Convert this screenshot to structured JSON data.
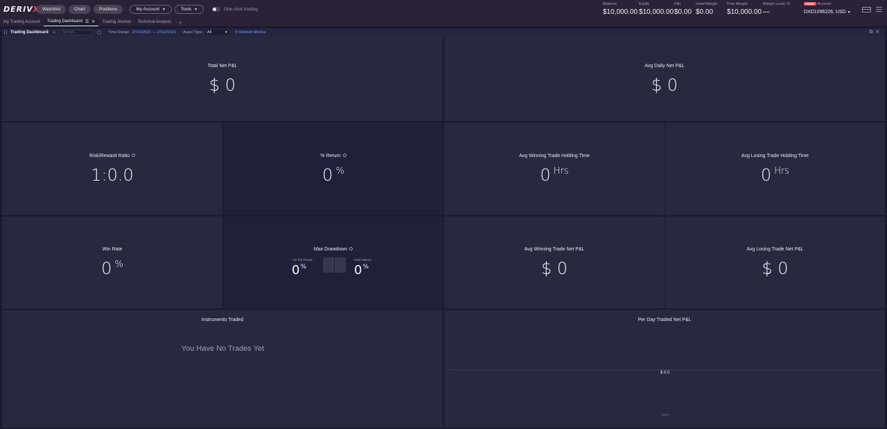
{
  "brand": {
    "logo_main": "DERIV",
    "logo_x": "X"
  },
  "topnav": {
    "watchlist": "Watchlist",
    "chart": "Chart",
    "positions": "Positions",
    "my_account": "My Account",
    "tools": "Tools",
    "one_click": "One-click trading"
  },
  "stats": {
    "balance": {
      "label": "Balance",
      "value": "$10,000.00"
    },
    "equity": {
      "label": "Equity",
      "value": "$10,000.00"
    },
    "pnl": {
      "label": "P&L",
      "value": "$0.00"
    },
    "used_margin": {
      "label": "Used Margin",
      "value": "$0.00"
    },
    "free_margin": {
      "label": "Free Margin",
      "value": "$10,000.00"
    },
    "margin_level": {
      "label": "Margin Level, %",
      "value": "—"
    },
    "account": {
      "badge": "DEMO",
      "label": "Account",
      "value": "DXD1096226, USD"
    }
  },
  "tabs": [
    "My Trading Account",
    "Trading Dashboard",
    "Trading Journal",
    "Technical Analysis"
  ],
  "toolbar": {
    "title": "Trading Dashboard",
    "symbol_placeholder": "Symbol...",
    "time_range_label": "Time Range:",
    "time_range_value": "27/12/2021 — 27/12/2021",
    "asset_type_label": "Asset Type:",
    "asset_type_value": "All",
    "refresh": "Refresh Metrics"
  },
  "metrics": {
    "total_net_pnl": {
      "label": "Total Net P&L",
      "value": "$ 0"
    },
    "avg_daily_net_pnl": {
      "label": "Avg Daily Net P&L",
      "value": "$ 0"
    },
    "risk_reward": {
      "label": "Risk/Reward Ratio",
      "value": "1:0.0"
    },
    "pct_return": {
      "label": "% Return",
      "value": "0",
      "unit": "%"
    },
    "avg_win_hold": {
      "label": "Avg Winning Trade Holding Time",
      "value": "0",
      "unit": "Hrs"
    },
    "avg_lose_hold": {
      "label": "Avg Losing Trade Holding Time",
      "value": "0",
      "unit": "Hrs"
    },
    "win_rate": {
      "label": "Win Rate",
      "value": "0",
      "unit": "%"
    },
    "max_drawdown": {
      "label": "Max Drawdown",
      "period_label": "For the Period",
      "period_value": "0",
      "history_label": "Total History",
      "history_value": "0",
      "unit": "%"
    },
    "avg_win_pnl": {
      "label": "Avg Winning Trade Net P&L",
      "value": "$ 0"
    },
    "avg_lose_pnl": {
      "label": "Avg Losing Trade Net P&L",
      "value": "$ 0"
    }
  },
  "instruments": {
    "label": "Instruments Traded",
    "empty": "You Have No Trades Yet"
  },
  "per_day": {
    "label": "Per Day Traded Net P&L",
    "value": "$ 0.0",
    "x_label": "MON"
  }
}
